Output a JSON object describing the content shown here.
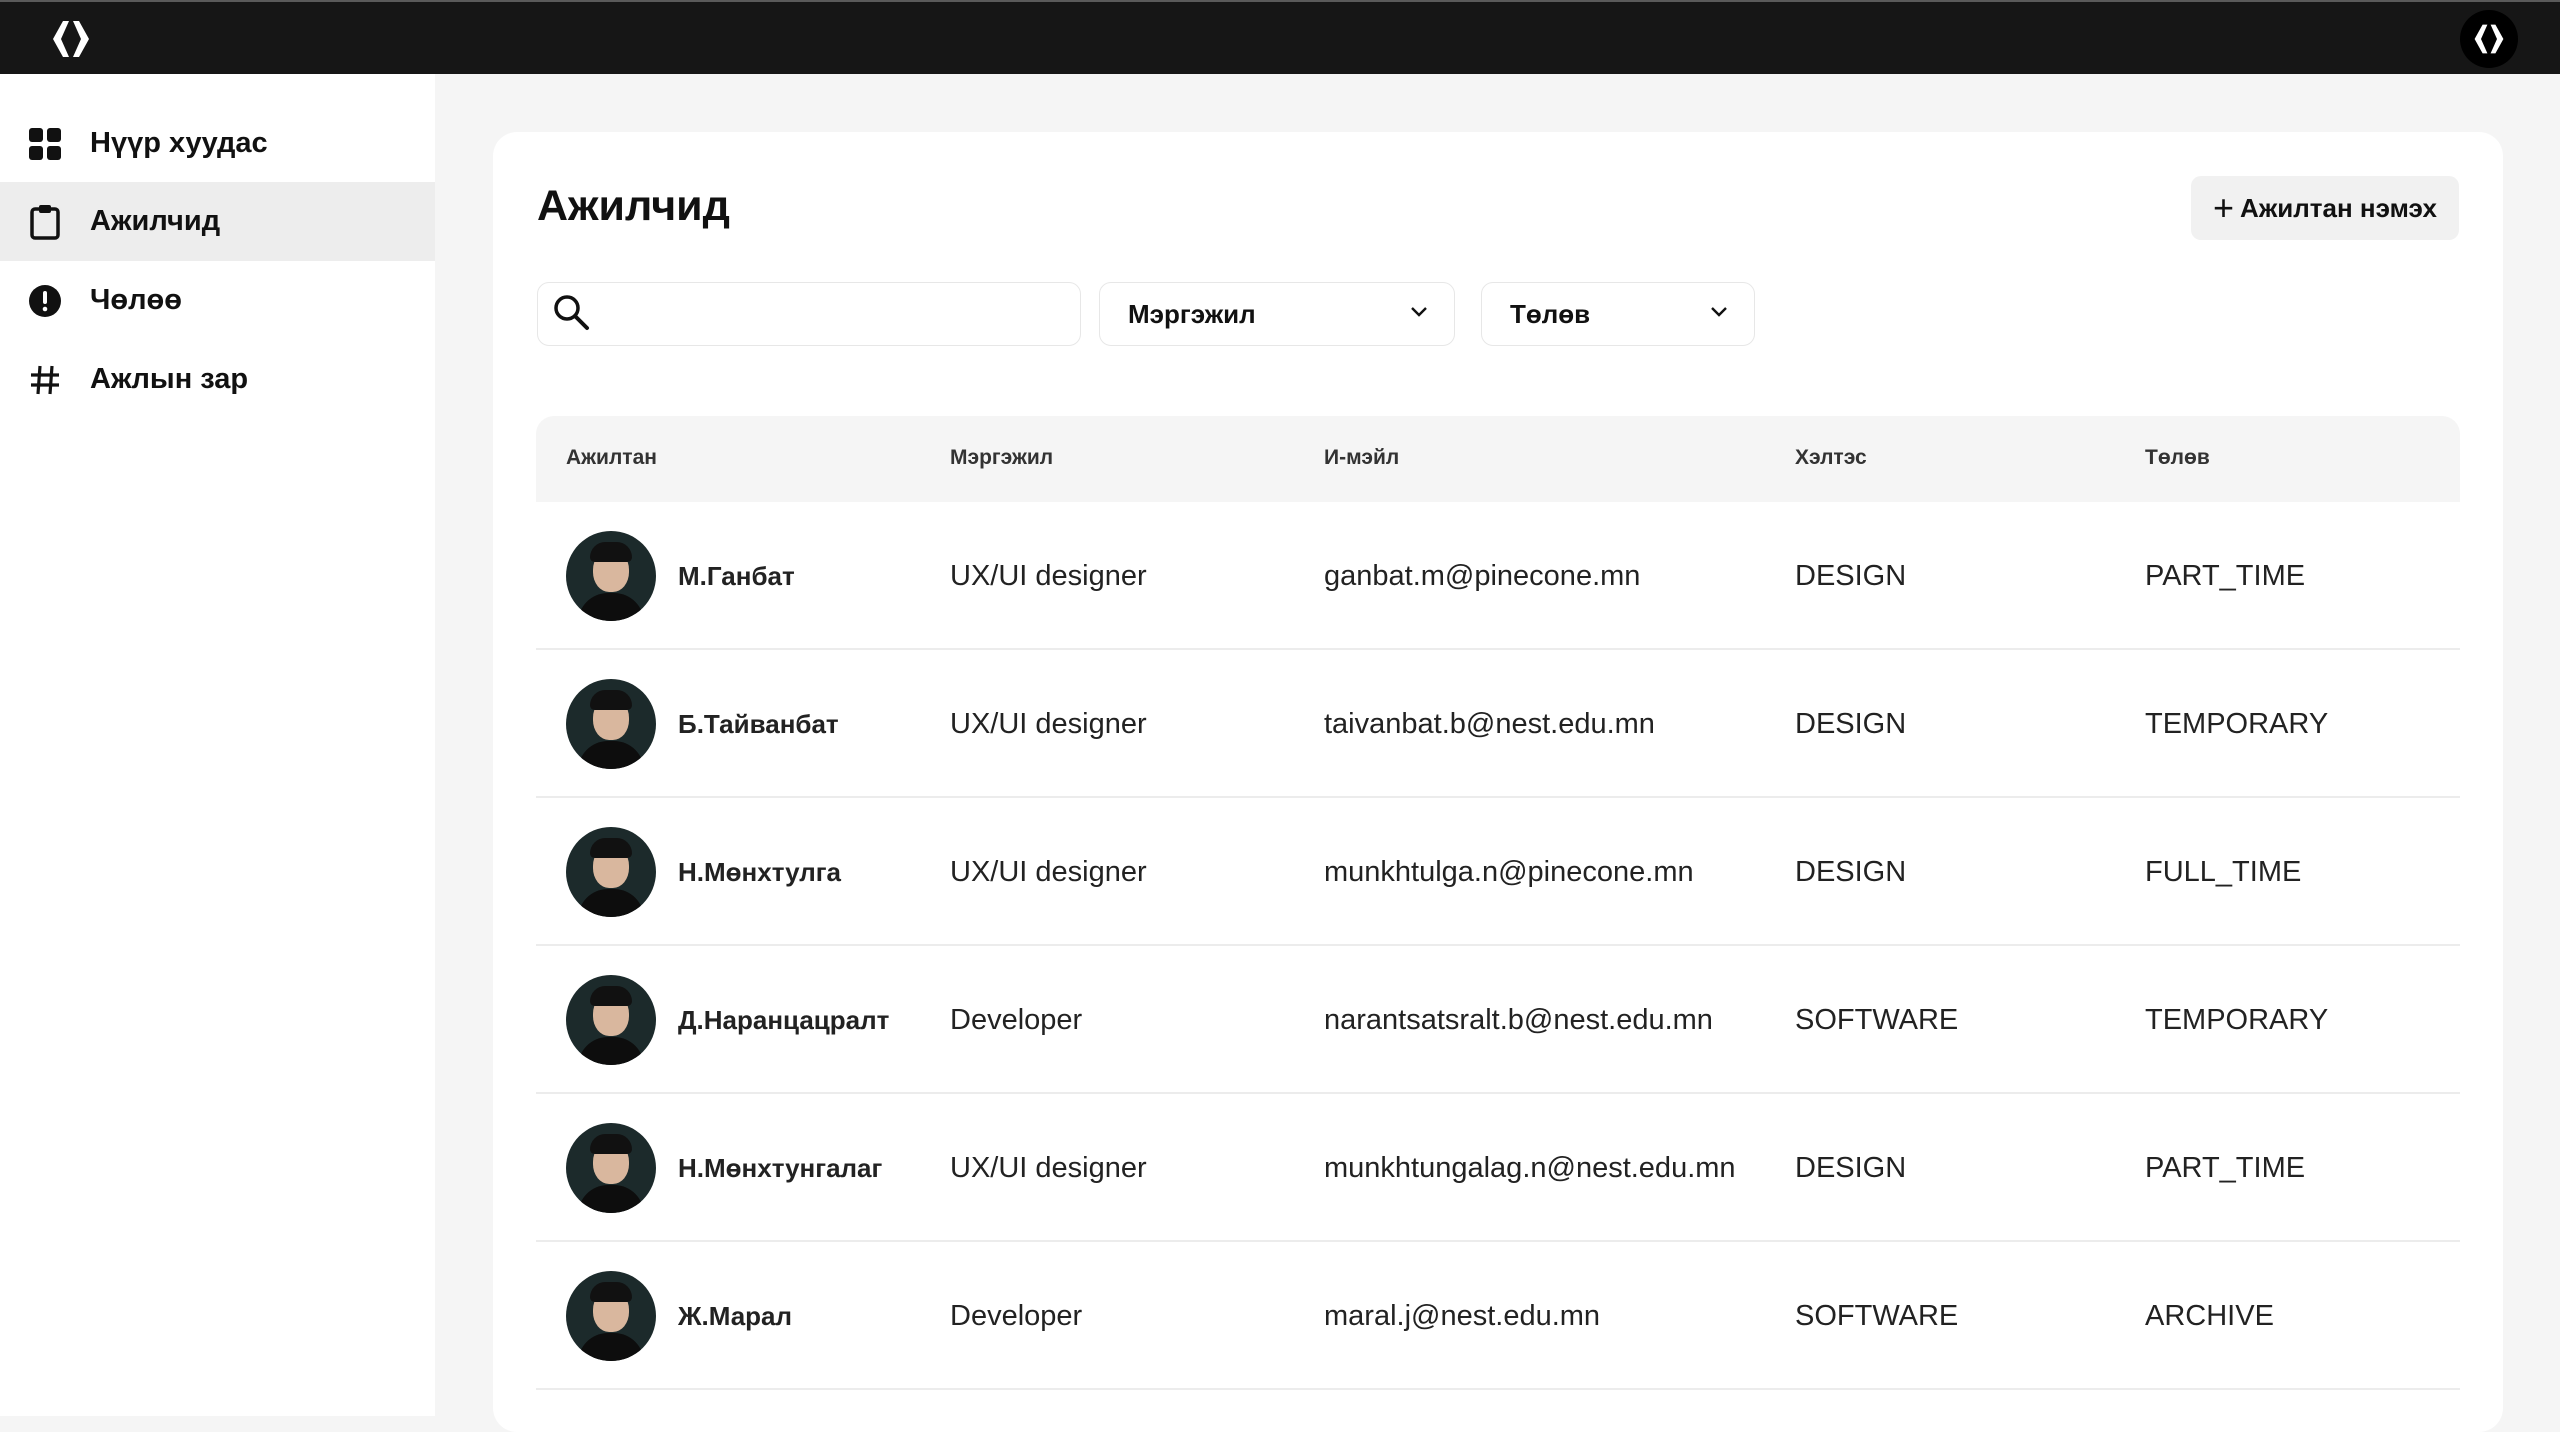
{
  "nav": [
    {
      "label": "Нүүр хуудас",
      "icon": "dashboard-grid-icon"
    },
    {
      "label": "Ажилчид",
      "icon": "clipboard-icon",
      "active": true
    },
    {
      "label": "Чөлөө",
      "icon": "alert-circle-icon"
    },
    {
      "label": "Ажлын зар",
      "icon": "hash-icon"
    }
  ],
  "page": {
    "title": "Ажилчид",
    "add_button": "Ажилтан нэмэх",
    "search_placeholder": "",
    "filter_profession": "Мэргэжил",
    "filter_status": "Төлөв"
  },
  "table": {
    "headers": [
      "Ажилтан",
      "Мэргэжил",
      "И-мэйл",
      "Хэлтэс",
      "Төлөв"
    ],
    "rows": [
      {
        "name": "М.Ганбат",
        "profession": "UX/UI designer",
        "email": "ganbat.m@pinecone.mn",
        "department": "DESIGN",
        "status": "PART_TIME"
      },
      {
        "name": "Б.Тайванбат",
        "profession": "UX/UI designer",
        "email": "taivanbat.b@nest.edu.mn",
        "department": "DESIGN",
        "status": "TEMPORARY"
      },
      {
        "name": "Н.Мөнхтулга",
        "profession": "UX/UI designer",
        "email": "munkhtulga.n@pinecone.mn",
        "department": "DESIGN",
        "status": "FULL_TIME"
      },
      {
        "name": "Д.Наранцацралт",
        "profession": "Developer",
        "email": "narantsatsralt.b@nest.edu.mn",
        "department": "SOFTWARE",
        "status": "TEMPORARY"
      },
      {
        "name": "Н.Мөнхтунгалаг",
        "profession": "UX/UI designer",
        "email": "munkhtungalag.n@nest.edu.mn",
        "department": "DESIGN",
        "status": "PART_TIME"
      },
      {
        "name": "Ж.Марал",
        "profession": "Developer",
        "email": "maral.j@nest.edu.mn",
        "department": "SOFTWARE",
        "status": "ARCHIVE"
      }
    ]
  }
}
